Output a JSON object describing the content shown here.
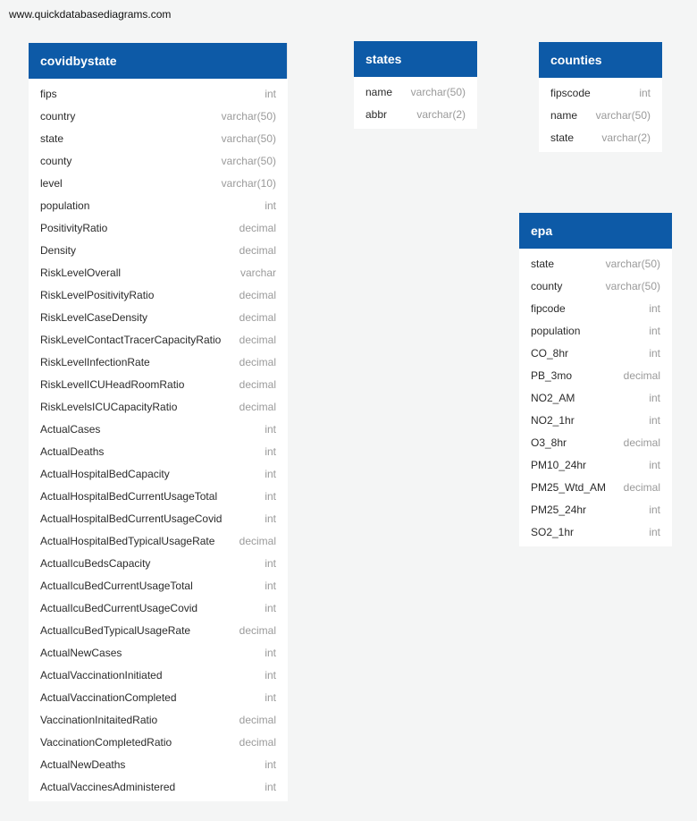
{
  "watermark": "www.quickdatabasediagrams.com",
  "tables": [
    {
      "id": "t-covid",
      "name": "covidbystate",
      "columns": [
        {
          "name": "fips",
          "type": "int"
        },
        {
          "name": "country",
          "type": "varchar(50)"
        },
        {
          "name": "state",
          "type": "varchar(50)"
        },
        {
          "name": "county",
          "type": "varchar(50)"
        },
        {
          "name": "level",
          "type": "varchar(10)"
        },
        {
          "name": "population",
          "type": "int"
        },
        {
          "name": "PositivityRatio",
          "type": "decimal"
        },
        {
          "name": "Density",
          "type": "decimal"
        },
        {
          "name": "RiskLevelOverall",
          "type": "varchar"
        },
        {
          "name": "RiskLevelPositivityRatio",
          "type": "decimal"
        },
        {
          "name": "RiskLevelCaseDensity",
          "type": "decimal"
        },
        {
          "name": "RiskLevelContactTracerCapacityRatio",
          "type": "decimal"
        },
        {
          "name": "RiskLevelInfectionRate",
          "type": "decimal"
        },
        {
          "name": "RiskLevelICUHeadRoomRatio",
          "type": "decimal"
        },
        {
          "name": "RiskLevelsICUCapacityRatio",
          "type": "decimal"
        },
        {
          "name": "ActualCases",
          "type": "int"
        },
        {
          "name": "ActualDeaths",
          "type": "int"
        },
        {
          "name": "ActualHospitalBedCapacity",
          "type": "int"
        },
        {
          "name": "ActualHospitalBedCurrentUsageTotal",
          "type": "int"
        },
        {
          "name": "ActualHospitalBedCurrentUsageCovid",
          "type": "int"
        },
        {
          "name": "ActualHospitalBedTypicalUsageRate",
          "type": "decimal"
        },
        {
          "name": "ActualIcuBedsCapacity",
          "type": "int"
        },
        {
          "name": "ActualIcuBedCurrentUsageTotal",
          "type": "int"
        },
        {
          "name": "ActualIcuBedCurrentUsageCovid",
          "type": "int"
        },
        {
          "name": "ActualIcuBedTypicalUsageRate",
          "type": "decimal"
        },
        {
          "name": "ActualNewCases",
          "type": "int"
        },
        {
          "name": "ActualVaccinationInitiated",
          "type": "int"
        },
        {
          "name": "ActualVaccinationCompleted",
          "type": "int"
        },
        {
          "name": "VaccinationInitaitedRatio",
          "type": "decimal"
        },
        {
          "name": "VaccinationCompletedRatio",
          "type": "decimal"
        },
        {
          "name": "ActualNewDeaths",
          "type": "int"
        },
        {
          "name": "ActualVaccinesAdministered",
          "type": "int"
        }
      ]
    },
    {
      "id": "t-states",
      "name": "states",
      "columns": [
        {
          "name": "name",
          "type": "varchar(50)"
        },
        {
          "name": "abbr",
          "type": "varchar(2)"
        }
      ]
    },
    {
      "id": "t-counties",
      "name": "counties",
      "columns": [
        {
          "name": "fipscode",
          "type": "int"
        },
        {
          "name": "name",
          "type": "varchar(50)"
        },
        {
          "name": "state",
          "type": "varchar(2)"
        }
      ]
    },
    {
      "id": "t-epa",
      "name": "epa",
      "columns": [
        {
          "name": "state",
          "type": "varchar(50)"
        },
        {
          "name": "county",
          "type": "varchar(50)"
        },
        {
          "name": "fipcode",
          "type": "int"
        },
        {
          "name": "population",
          "type": "int"
        },
        {
          "name": "CO_8hr",
          "type": "int"
        },
        {
          "name": "PB_3mo",
          "type": "decimal"
        },
        {
          "name": "NO2_AM",
          "type": "int"
        },
        {
          "name": "NO2_1hr",
          "type": "int"
        },
        {
          "name": "O3_8hr",
          "type": "decimal"
        },
        {
          "name": "PM10_24hr",
          "type": "int"
        },
        {
          "name": "PM25_Wtd_AM",
          "type": "decimal"
        },
        {
          "name": "PM25_24hr",
          "type": "int"
        },
        {
          "name": "SO2_1hr",
          "type": "int"
        }
      ]
    }
  ]
}
